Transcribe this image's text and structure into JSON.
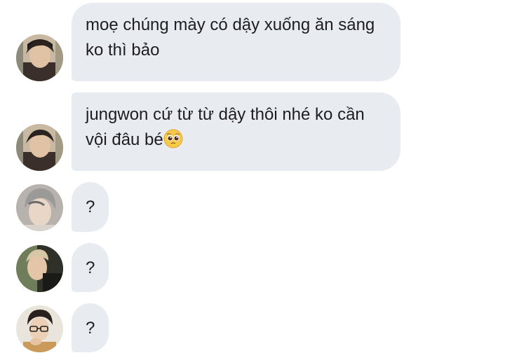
{
  "messages": [
    {
      "sender": "user-a",
      "text": "moẹ chúng mày có dậy xuống ăn sáng ko thì bảo"
    },
    {
      "sender": "user-a",
      "text": "jungwon cứ từ từ dậy thôi nhé ko cần vội đâu bé",
      "emoji": "pleading-face-emoji"
    },
    {
      "sender": "user-b",
      "text": "?"
    },
    {
      "sender": "user-c",
      "text": "?"
    },
    {
      "sender": "user-d",
      "text": "?"
    }
  ],
  "colors": {
    "bubble": "#e8ecf0",
    "text": "#1c1e21",
    "background": "#ffffff"
  }
}
